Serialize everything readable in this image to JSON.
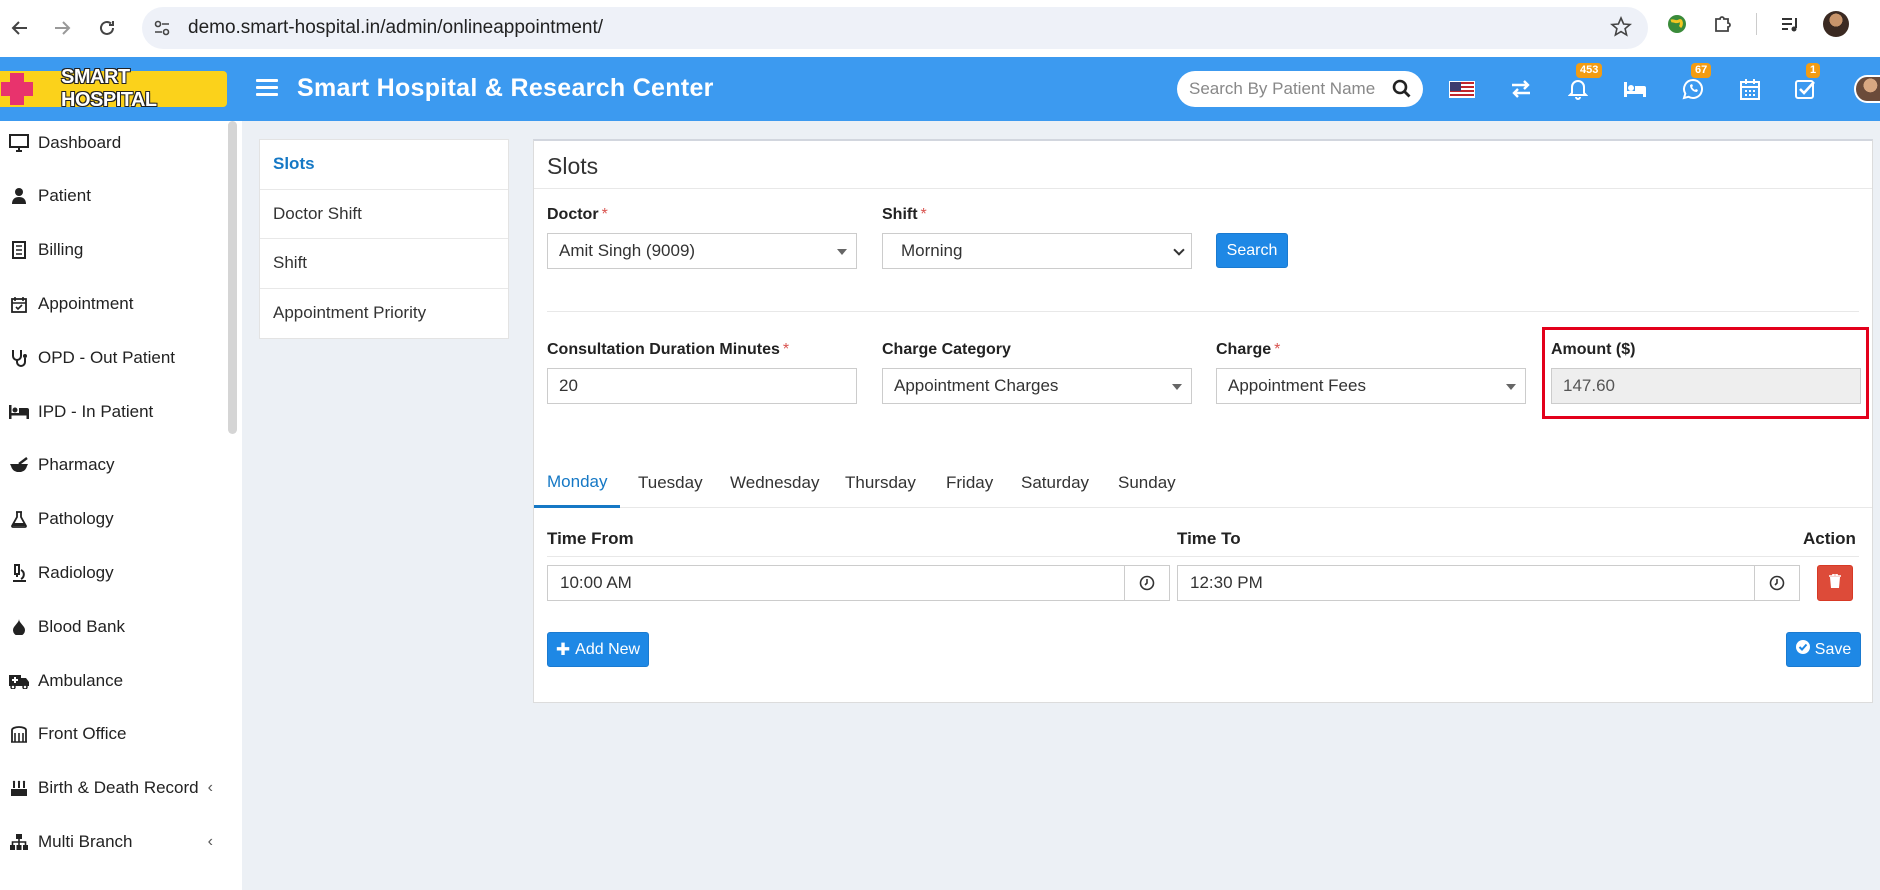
{
  "browser": {
    "url": "demo.smart-hospital.in/admin/onlineappointment/"
  },
  "header": {
    "logo_text": "SMART HOSPITAL",
    "title": "Smart Hospital & Research Center",
    "search_placeholder": "Search By Patient Name",
    "notifications_count": "453",
    "whatsapp_count": "67",
    "tasks_count": "1",
    "brand_color": "#3c9af0"
  },
  "sidebar": {
    "items": [
      {
        "label": "Dashboard",
        "icon": "monitor-icon"
      },
      {
        "label": "Patient",
        "icon": "user-icon"
      },
      {
        "label": "Billing",
        "icon": "invoice-icon"
      },
      {
        "label": "Appointment",
        "icon": "calendar-check-icon"
      },
      {
        "label": "OPD - Out Patient",
        "icon": "stethoscope-icon"
      },
      {
        "label": "IPD - In Patient",
        "icon": "bed-icon"
      },
      {
        "label": "Pharmacy",
        "icon": "mortar-pestle-icon"
      },
      {
        "label": "Pathology",
        "icon": "flask-icon"
      },
      {
        "label": "Radiology",
        "icon": "microscope-icon"
      },
      {
        "label": "Blood Bank",
        "icon": "drop-icon"
      },
      {
        "label": "Ambulance",
        "icon": "ambulance-icon"
      },
      {
        "label": "Front Office",
        "icon": "building-icon"
      },
      {
        "label": "Birth & Death Record",
        "icon": "birthday-cake-icon"
      },
      {
        "label": "Multi Branch",
        "icon": "sitemap-icon"
      }
    ]
  },
  "submenu": {
    "items": [
      "Slots",
      "Doctor Shift",
      "Shift",
      "Appointment Priority"
    ]
  },
  "panel": {
    "title": "Slots",
    "doctor_label": "Doctor",
    "doctor_value": "Amit Singh (9009)",
    "shift_label": "Shift",
    "shift_value": "Morning",
    "search_button": "Search",
    "duration_label": "Consultation Duration Minutes",
    "duration_value": "20",
    "charge_category_label": "Charge Category",
    "charge_category_value": "Appointment Charges",
    "charge_label": "Charge",
    "charge_value": "Appointment Fees",
    "amount_label": "Amount ($)",
    "amount_value": "147.60",
    "required_mark": "*"
  },
  "days": [
    "Monday",
    "Tuesday",
    "Wednesday",
    "Thursday",
    "Friday",
    "Saturday",
    "Sunday"
  ],
  "slot_table": {
    "col_from": "Time From",
    "col_to": "Time To",
    "col_action": "Action",
    "rows": [
      {
        "from": "10:00 AM",
        "to": "12:30 PM"
      }
    ]
  },
  "actions": {
    "add_new": "Add New",
    "save": "Save"
  }
}
